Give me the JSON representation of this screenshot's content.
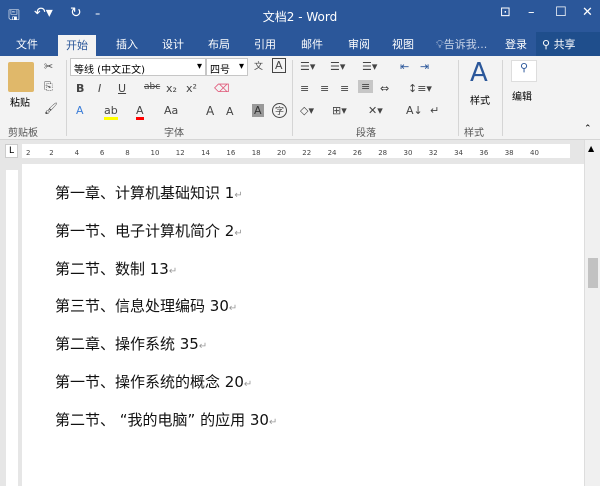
{
  "titlebar": {
    "title": "文档2 - Word",
    "save_icon": "save-icon",
    "undo_icon": "undo-icon",
    "redo_icon": "redo-icon",
    "customize_icon": "customize-icon"
  },
  "tabs": [
    {
      "label": "文件"
    },
    {
      "label": "开始",
      "active": true
    },
    {
      "label": "插入"
    },
    {
      "label": "设计"
    },
    {
      "label": "布局"
    },
    {
      "label": "引用"
    },
    {
      "label": "邮件"
    },
    {
      "label": "审阅"
    },
    {
      "label": "视图"
    }
  ],
  "tell_me": "告诉我...",
  "login": "登录",
  "share": "共享",
  "ribbon": {
    "paste": "粘贴",
    "clipboard": "剪贴板",
    "font_name": "等线 (中文正文)",
    "font_size": "四号",
    "font_group": "字体",
    "paragraph_group": "段落",
    "styles_label": "样式",
    "styles_group": "样式",
    "editing": "编辑",
    "bold": "B",
    "italic": "I",
    "underline": "U",
    "strike": "abc",
    "sub": "x₂",
    "sup": "x²",
    "change_case": "Aa",
    "grow": "A",
    "shrink": "A",
    "char_shade": "A",
    "enclose": "字",
    "pinyin": "文",
    "border_char": "A"
  },
  "ruler": {
    "tab_selector": "L",
    "ticks": [
      "2",
      "2",
      "4",
      "6",
      "8",
      "10",
      "12",
      "14",
      "16",
      "18",
      "20",
      "22",
      "24",
      "26",
      "28",
      "30",
      "32",
      "34",
      "36",
      "38",
      "40"
    ]
  },
  "document": {
    "lines": [
      {
        "text": "第一章、计算机基础知识  1"
      },
      {
        "text": "第一节、电子计算机简介  2"
      },
      {
        "text": "第二节、数制    13"
      },
      {
        "text": "第三节、信息处理编码 30"
      },
      {
        "text": "第二章、操作系统  35"
      },
      {
        "text": "第一节、操作系统的概念  20"
      },
      {
        "text": "第二节、 “我的电脑” 的应用 30"
      }
    ],
    "paragraph_mark": "↵"
  },
  "colors": {
    "brand": "#2b579a",
    "highlight": "#ffff00",
    "font_color": "#ff0000"
  }
}
